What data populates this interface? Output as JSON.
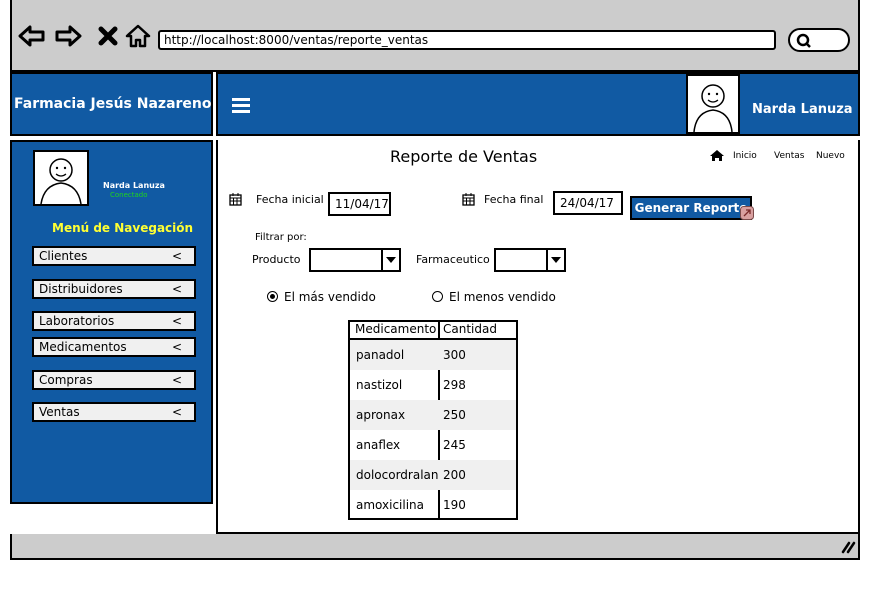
{
  "browser": {
    "url": "http://localhost:8000/ventas/reporte_ventas",
    "back_icon": "arrow-left-icon",
    "forward_icon": "arrow-right-icon",
    "stop_icon": "close-icon",
    "home_icon": "home-icon",
    "search_icon": "search-icon"
  },
  "header": {
    "brand": "Farmacia Jesús Nazareno",
    "user_name": "Narda Lanuza"
  },
  "sidebar": {
    "user_name": "Narda Lanuza",
    "status": "Conectado",
    "nav_title": "Menú de Navegación",
    "items": [
      {
        "label": "Clientes",
        "chevron": "<"
      },
      {
        "label": "Distribuidores",
        "chevron": "<"
      },
      {
        "label": "Laboratorios",
        "chevron": "<"
      },
      {
        "label": "Medicamentos",
        "chevron": "<"
      },
      {
        "label": "Compras",
        "chevron": "<"
      },
      {
        "label": "Ventas",
        "chevron": "<"
      }
    ]
  },
  "content": {
    "title": "Reporte de Ventas",
    "breadcrumb": [
      "Inicio",
      "Ventas",
      "Nuevo"
    ],
    "fecha_inicial_label": "Fecha inicial",
    "fecha_inicial_value": "11/04/17",
    "fecha_final_label": "Fecha final",
    "fecha_final_value": "24/04/17",
    "generate_button": "Generar Reporte",
    "filter_label": "Filtrar por:",
    "producto_label": "Producto",
    "farmaceutico_label": "Farmaceutico",
    "radio_most": "El más vendido",
    "radio_least": "El menos vendido",
    "selected_radio": "most"
  },
  "table": {
    "headers": [
      "Medicamento",
      "Cantidad"
    ],
    "rows": [
      [
        "panadol",
        "300"
      ],
      [
        "nastizol",
        "298"
      ],
      [
        "apronax",
        "250"
      ],
      [
        "anaflex",
        "245"
      ],
      [
        "dolocordralan",
        "200"
      ],
      [
        "amoxicilina",
        "190"
      ]
    ]
  },
  "colors": {
    "primary": "#115aa3",
    "chrome": "#cccccc",
    "nav_title": "#ffff33",
    "status": "#1fd41f"
  }
}
